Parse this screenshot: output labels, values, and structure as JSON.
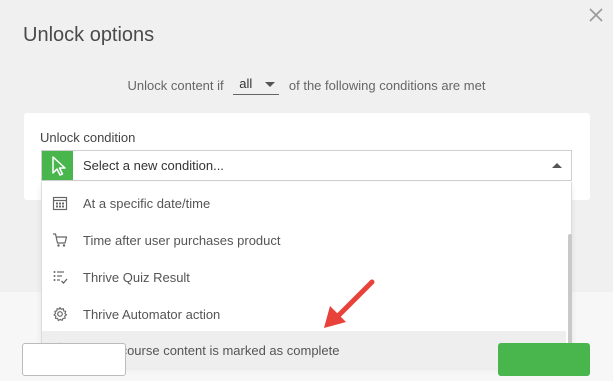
{
  "dialog": {
    "title": "Unlock options",
    "close_icon": "close-icon"
  },
  "rule": {
    "prefix": "Unlock content if",
    "match_value": "all",
    "suffix": "of the following conditions are met"
  },
  "condition": {
    "label": "Unlock condition",
    "placeholder": "Select a new condition...",
    "icon": "cursor-icon",
    "options": [
      {
        "label": "At a specific date/time",
        "icon": "calendar-icon"
      },
      {
        "label": "Time after user purchases product",
        "icon": "cart-icon"
      },
      {
        "label": "Thrive Quiz Result",
        "icon": "checklist-icon"
      },
      {
        "label": "Thrive Automator action",
        "icon": "gear-icon"
      },
      {
        "label": "When course content is marked as complete",
        "icon": "check-circle-icon",
        "highlighted": true
      }
    ]
  },
  "colors": {
    "accent": "#48b54d",
    "arrow": "#e8423b"
  }
}
